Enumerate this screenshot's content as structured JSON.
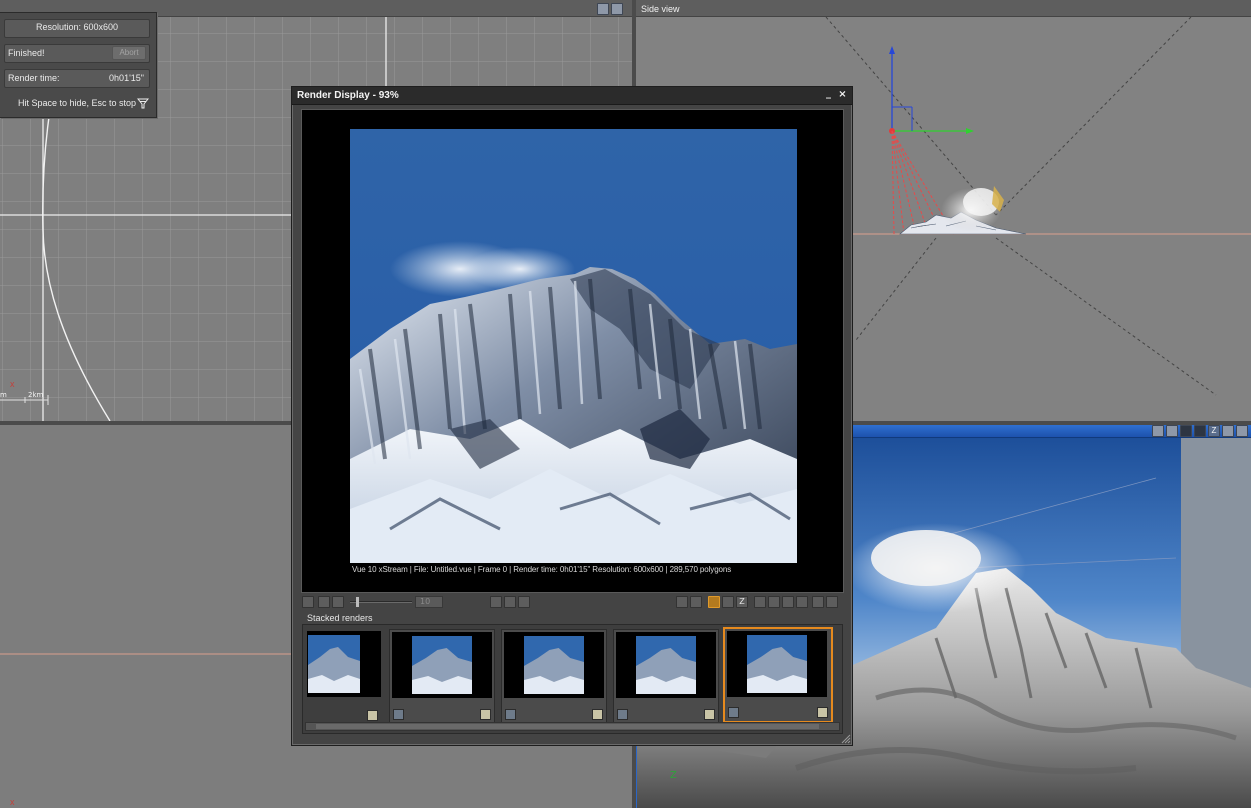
{
  "render_info": {
    "resolution": "Resolution: 600x600",
    "status": "Finished!",
    "abort_label": "Abort",
    "render_time_label": "Render time:",
    "render_time_value": "0h01'15\"",
    "hint": "Hit Space to hide, Esc to stop"
  },
  "top_left_view": {
    "scale_labels": [
      "m",
      "2km"
    ]
  },
  "side_view": {
    "title": "Side view"
  },
  "render_display": {
    "title": "Render Display - 93%",
    "minimize": "_",
    "close": "×",
    "caption": "Vue 10 xStream | File: Untitled.vue | Frame 0 | Render time: 0h01'15\"  Resolution: 600x600 | 289,570 polygons",
    "frame_number": "10",
    "stacked_label": "Stacked renders",
    "thumbnail_count": 5,
    "selected_thumbnail": 5
  },
  "perspective_view": {
    "header_color": "#2a66c8"
  },
  "colors": {
    "viewport_bg": "#808080",
    "selection_orange": "#e68a1e",
    "panel_dark": "#444444"
  }
}
